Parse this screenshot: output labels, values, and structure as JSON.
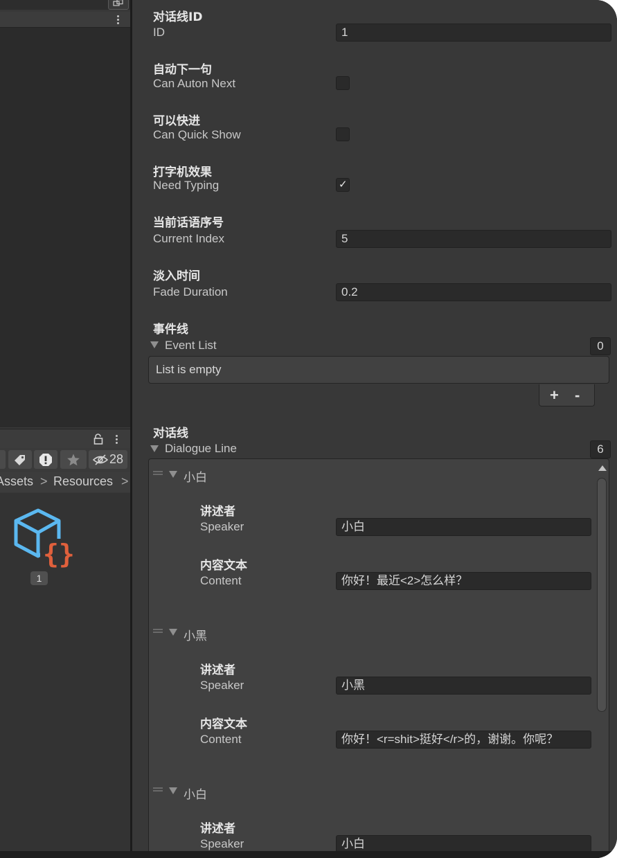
{
  "left_panel": {
    "toolbar_hidden_count": "28",
    "breadcrumb": {
      "item_1": "Assets",
      "sep_1": ">",
      "item_2": "Resources",
      "sep_2": ">"
    },
    "asset_label": "1"
  },
  "inspector": {
    "fields": {
      "id": {
        "label_cn": "对话线ID",
        "label_en": "ID",
        "value": "1"
      },
      "auto_next": {
        "label_cn": "自动下一句",
        "label_en": "Can Auton Next",
        "checked": false
      },
      "quick_show": {
        "label_cn": "可以快进",
        "label_en": "Can Quick Show",
        "checked": false
      },
      "need_typing": {
        "label_cn": "打字机效果",
        "label_en": "Need Typing",
        "checked": true,
        "check_glyph": "✓"
      },
      "current_index": {
        "label_cn": "当前话语序号",
        "label_en": "Current Index",
        "value": "5"
      },
      "fade_duration": {
        "label_cn": "淡入时间",
        "label_en": "Fade Duration",
        "value": "0.2"
      }
    },
    "event_list": {
      "label_cn": "事件线",
      "label_en": "Event List",
      "size": "0",
      "empty_text": "List is empty",
      "add_label": "+",
      "remove_label": "-"
    },
    "dialogue_line": {
      "label_cn": "对话线",
      "label_en": "Dialogue Line",
      "size": "6",
      "elements": [
        {
          "title": "小白",
          "speaker_cn": "讲述者",
          "speaker_en": "Speaker",
          "speaker_value": "小白",
          "content_cn": "内容文本",
          "content_en": "Content",
          "content_value": "你好！最近<2>怎么样？"
        },
        {
          "title": "小黑",
          "speaker_cn": "讲述者",
          "speaker_en": "Speaker",
          "speaker_value": "小黑",
          "content_cn": "内容文本",
          "content_en": "Content",
          "content_value": "你好！<r=shit>挺好</r>的，谢谢。你呢？"
        },
        {
          "title": "小白",
          "speaker_cn": "讲述者",
          "speaker_en": "Speaker",
          "speaker_value": "小白"
        }
      ]
    }
  },
  "colors": {
    "panel_bg": "#383838",
    "field_bg": "#2a2a2a",
    "list_bg": "#414141",
    "asset_cube_blue": "#5bb8f0",
    "asset_braces_orange": "#e0603c"
  }
}
